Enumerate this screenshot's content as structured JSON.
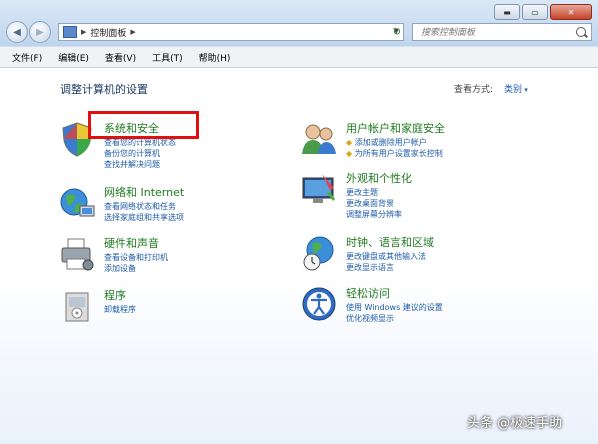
{
  "window": {
    "controls": {
      "minimize": "▬",
      "maximize": "▭",
      "close": "✕"
    }
  },
  "nav": {
    "back": "◀",
    "forward": "▶",
    "address_crumb": "控制面板",
    "address_separator": "▶",
    "refresh": "↻",
    "search_placeholder": "搜索控制面板"
  },
  "menu": [
    "文件(F)",
    "编辑(E)",
    "查看(V)",
    "工具(T)",
    "帮助(H)"
  ],
  "content": {
    "heading": "调整计算机的设置",
    "view_by_label": "查看方式:",
    "view_by_value": "类别"
  },
  "categories_left": [
    {
      "title": "系统和安全",
      "icon": "shield-icon",
      "links": [
        "查看您的计算机状态",
        "备份您的计算机",
        "查找并解决问题"
      ]
    },
    {
      "title": "网络和 Internet",
      "icon": "globe-network-icon",
      "links": [
        "查看网络状态和任务",
        "选择家庭组和共享选项"
      ]
    },
    {
      "title": "硬件和声音",
      "icon": "printer-icon",
      "links": [
        "查看设备和打印机",
        "添加设备"
      ]
    },
    {
      "title": "程序",
      "icon": "programs-icon",
      "links": [
        "卸载程序"
      ]
    }
  ],
  "categories_right": [
    {
      "title": "用户帐户和家庭安全",
      "icon": "users-icon",
      "links": [
        "添加或删除用户帐户",
        "为所有用户设置家长控制"
      ]
    },
    {
      "title": "外观和个性化",
      "icon": "appearance-icon",
      "links": [
        "更改主题",
        "更改桌面背景",
        "调整屏幕分辨率"
      ]
    },
    {
      "title": "时钟、语言和区域",
      "icon": "clock-globe-icon",
      "links": [
        "更改键盘或其他输入法",
        "更改显示语言"
      ]
    },
    {
      "title": "轻松访问",
      "icon": "ease-of-access-icon",
      "links": [
        "使用 Windows 建议的设置",
        "优化视频显示"
      ]
    }
  ],
  "watermark": "头条 @极速手助",
  "colors": {
    "title_green": "#1f7a1f",
    "link_blue": "#1e5ba8",
    "highlight_red": "#e01010"
  }
}
